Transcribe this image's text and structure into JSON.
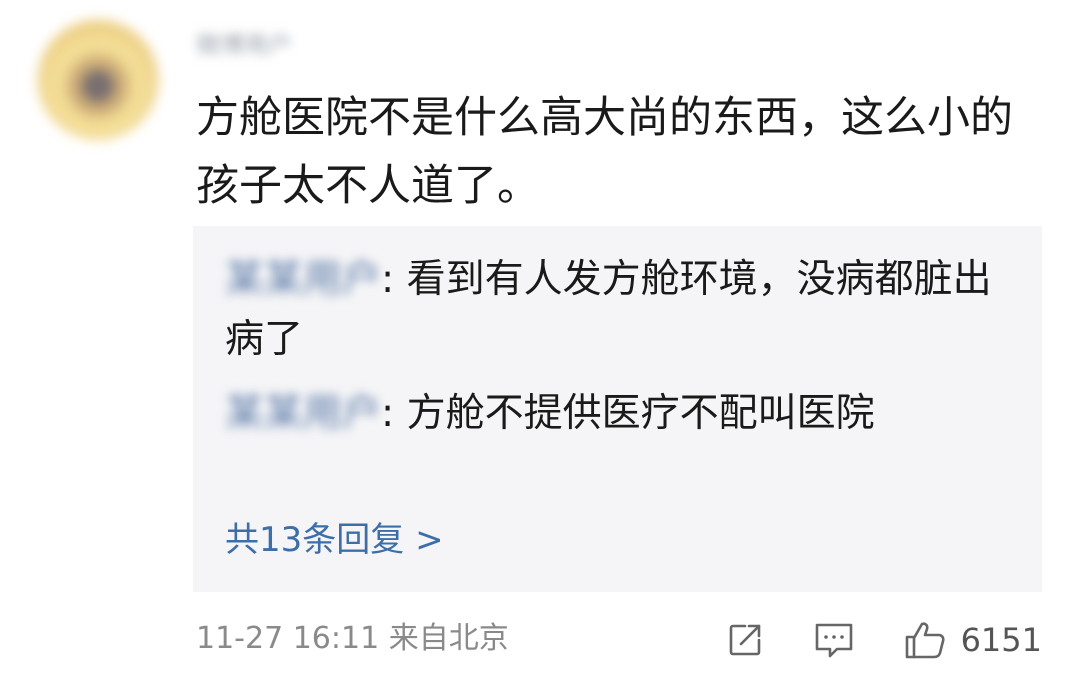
{
  "comment": {
    "author": "微博用户",
    "text": "方舱医院不是什么高大尚的东西，这么小的孩子太不人道了。",
    "timestamp": "11-27 16:11",
    "location": "来自北京",
    "like_count": "6151"
  },
  "replies": [
    {
      "author": "某某用户",
      "separator": ": ",
      "text": "看到有人发方舱环境，没病都脏出病了"
    },
    {
      "author": "某某用户",
      "separator": ": ",
      "text": "方舱不提供医疗不配叫医院"
    }
  ],
  "view_all_replies": "共13条回复 >",
  "icons": {
    "share": "share-icon",
    "comment": "comment-icon",
    "like": "thumbs-up-icon"
  },
  "colors": {
    "link": "#3e6ea8",
    "reply_bg": "#f5f5f7",
    "meta": "#8a8a8a"
  }
}
